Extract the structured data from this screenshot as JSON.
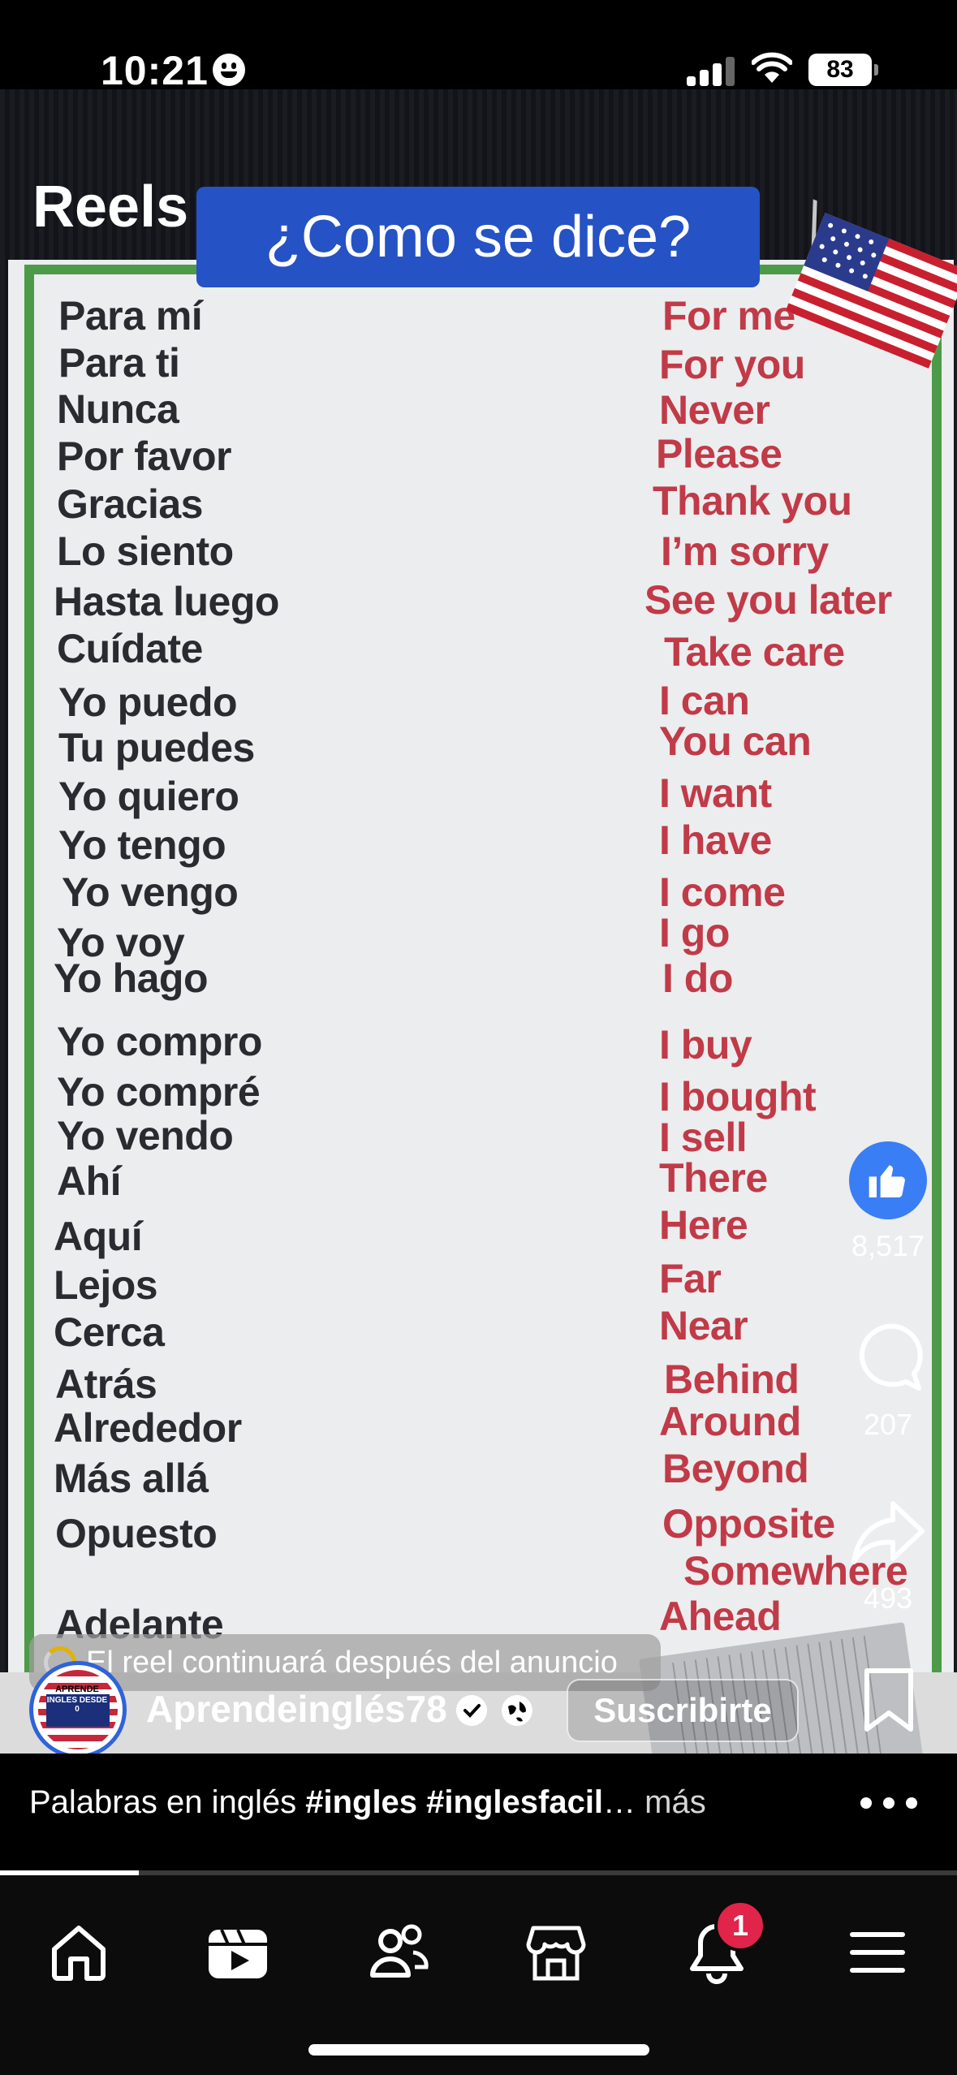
{
  "status_bar": {
    "time": "10:21",
    "battery": "83"
  },
  "header": {
    "title": "Reels"
  },
  "video": {
    "banner": "¿Como se dice?",
    "spanish_words": [
      "Para mí",
      "Para ti",
      "Nunca",
      "Por favor",
      "Gracias",
      "Lo siento",
      "Hasta luego",
      "Cuídate",
      "Yo puedo",
      "Tu puedes",
      "Yo quiero",
      "Yo tengo",
      "Yo vengo",
      "Yo voy",
      "Yo hago",
      "Yo compro",
      "Yo compré",
      "Yo vendo",
      "Ahí",
      "Aquí",
      "Lejos",
      "Cerca",
      "Atrás",
      "Alrededor",
      "Más allá",
      "Opuesto",
      "Adelante"
    ],
    "english_words": [
      "For me",
      "For you",
      "Never",
      "Please",
      "Thank you",
      "I’m sorry",
      "See you later",
      "Take care",
      "I can",
      "You can",
      "I want",
      "I have",
      "I come",
      "I go",
      "I do",
      "I buy",
      "I bought",
      "I sell",
      "There",
      "Here",
      "Far",
      "Near",
      "Behind",
      "Around",
      "Beyond",
      "Opposite",
      "Somewhere",
      "Ahead"
    ],
    "ad_notice": "El reel continuará después del anuncio"
  },
  "actions": {
    "likes": "8,517",
    "comments": "207",
    "shares": "493"
  },
  "creator": {
    "name": "Aprendeinglés78",
    "avatar_line1": "APRENDE",
    "avatar_line2": "INGLES DESDE 0",
    "subscribe_label": "Suscribirte"
  },
  "caption": {
    "text": "Palabras en inglés ",
    "tag1": "#ingles",
    "tag2": " #inglesfacil",
    "ellipsis": "… ",
    "more": "más"
  },
  "playback": {
    "progress_fraction": 0.145
  },
  "tab_bar": {
    "notification_count": "1"
  },
  "colors": {
    "accent_blue": "#2552c4",
    "like_blue": "#3a7ef5",
    "english_red": "#c13a48",
    "frame_green": "#4d9b48",
    "badge_red": "#e0244a"
  }
}
